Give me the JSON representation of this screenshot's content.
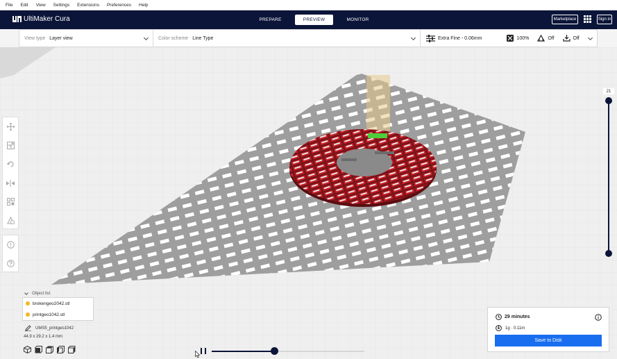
{
  "menu": [
    "File",
    "Edit",
    "View",
    "Settings",
    "Extensions",
    "Preferences",
    "Help"
  ],
  "header": {
    "brand": "UltiMaker Cura",
    "stages": [
      "PREPARE",
      "PREVIEW",
      "MONITOR"
    ],
    "active_stage": "PREVIEW",
    "marketplace_label": "Marketplace",
    "signin_label": "Sign in"
  },
  "toolbar": {
    "view_type_label": "View type",
    "view_type_value": "Layer view",
    "color_scheme_label": "Color scheme",
    "color_scheme_value": "Line Type",
    "profile": "Extra Fine - 0.06mm",
    "infill": "100%",
    "support": "Off",
    "adhesion": "Off"
  },
  "layer_slider": {
    "current_layer": "21",
    "top_fraction": 1.0,
    "bottom_fraction": 0.0
  },
  "object_list": {
    "title": "Object list",
    "items": [
      "brokengeo2042.stl",
      "printgeo1042.stl"
    ],
    "job_name": "UMS5_printgeo1042",
    "dimensions": "44.9 x 29.2 x 1.4 mm"
  },
  "simulation": {
    "progress": 0.41
  },
  "print_info": {
    "time": "29 minutes",
    "material": "1g · 0.11m",
    "save_label": "Save to Disk"
  },
  "colors": {
    "header": "#0b1539",
    "accent": "#196ef0",
    "wall_red": "#c7202a",
    "infill_gray": "#8a8a8a",
    "model_yellow": "#f4b624"
  }
}
